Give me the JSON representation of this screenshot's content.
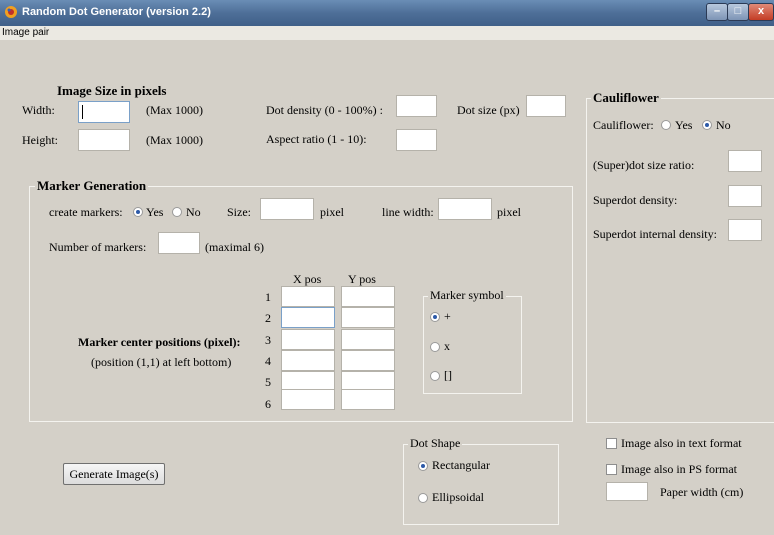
{
  "window": {
    "title": "Random Dot Generator (version 2.2)",
    "minimize": "–",
    "maximize": "□",
    "close": "x"
  },
  "menu": {
    "items": [
      "Image pair"
    ]
  },
  "image_size": {
    "heading": "Image Size in pixels",
    "width_label": "Width:",
    "width_value": "",
    "width_max": "(Max 1000)",
    "height_label": "Height:",
    "height_value": "",
    "height_max": "(Max 1000)"
  },
  "density": {
    "label": "Dot density (0 - 100%) :",
    "value": ""
  },
  "dot_size": {
    "label": "Dot size (px)",
    "value": ""
  },
  "aspect": {
    "label": "Aspect ratio (1 - 10):",
    "value": ""
  },
  "marker": {
    "group_title": "Marker Generation",
    "create_label": "create markers:",
    "yes": "Yes",
    "no": "No",
    "create_selected": "Yes",
    "size_label": "Size:",
    "size_value": "",
    "size_unit": "pixel",
    "line_width_label": "line width:",
    "line_width_value": "",
    "line_width_unit": "pixel",
    "count_label": "Number of markers:",
    "count_value": "",
    "count_max": "(maximal 6)",
    "positions_title": "Marker center positions (pixel):",
    "positions_note": "(position (1,1) at left bottom)",
    "xpos_header": "X pos",
    "ypos_header": "Y pos",
    "rows": [
      "1",
      "2",
      "3",
      "4",
      "5",
      "6"
    ],
    "symbol_title": "Marker symbol",
    "symbols": [
      "+",
      "x",
      "[]"
    ],
    "symbol_selected": "+"
  },
  "cauliflower": {
    "title": "Cauliflower",
    "label": "Cauliflower:",
    "yes": "Yes",
    "no": "No",
    "selected": "No",
    "ratio_label": "(Super)dot size ratio:",
    "ratio_value": "",
    "superdot_density_label": "Superdot density:",
    "superdot_density_value": "",
    "internal_density_label": "Superdot internal density:",
    "internal_density_value": ""
  },
  "dot_shape": {
    "title": "Dot Shape",
    "options": [
      "Rectangular",
      "Ellipsoidal"
    ],
    "selected": "Rectangular"
  },
  "output": {
    "text_format_label": "Image also in text format",
    "text_format_checked": false,
    "ps_format_label": "Image also in PS format",
    "ps_format_checked": false,
    "paper_width_label": "Paper width (cm)",
    "paper_width_value": ""
  },
  "generate_button": "Generate Image(s)"
}
